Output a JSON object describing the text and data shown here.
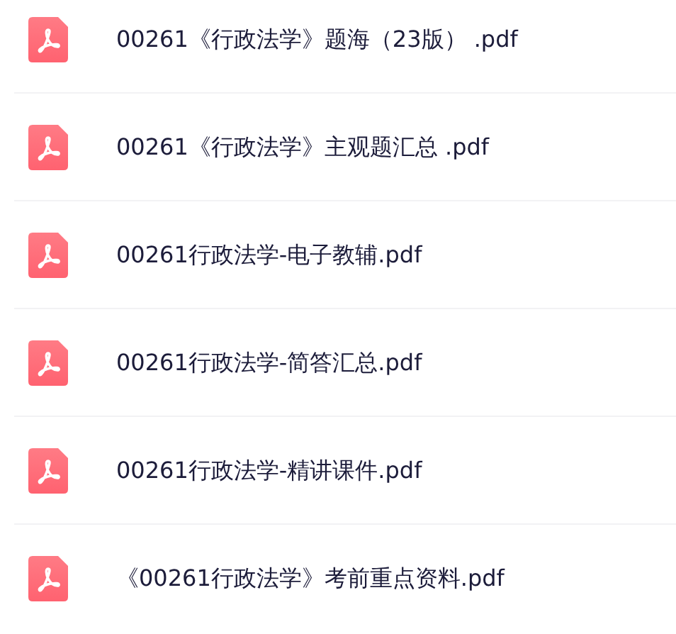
{
  "files": [
    {
      "name": "00261《行政法学》题海（23版） .pdf"
    },
    {
      "name": "00261《行政法学》主观题汇总 .pdf"
    },
    {
      "name": "00261行政法学-电子教辅.pdf"
    },
    {
      "name": "00261行政法学-简答汇总.pdf"
    },
    {
      "name": "00261行政法学-精讲课件.pdf"
    },
    {
      "name": "《00261行政法学》考前重点资料.pdf"
    }
  ]
}
